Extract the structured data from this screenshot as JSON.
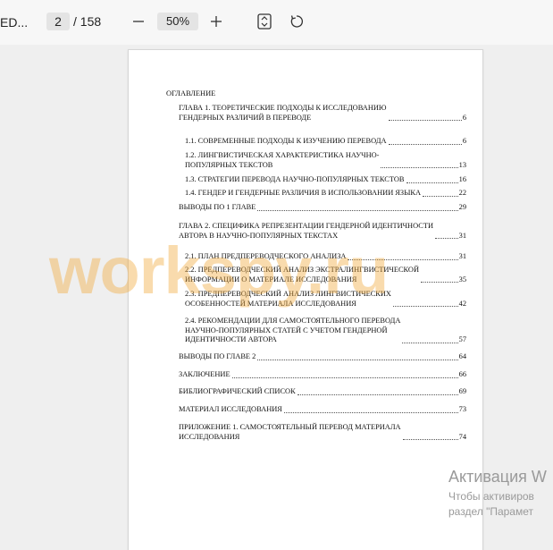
{
  "toolbar": {
    "doc_title": "ED...",
    "current_page": "2",
    "total_pages": "/ 158",
    "zoom": "50%"
  },
  "document": {
    "toc_heading": "ОГЛАВЛЕНИЕ",
    "toc": [
      {
        "text": "ГЛАВА 1. ТЕОРЕТИЧЕСКИЕ ПОДХОДЫ К ИССЛЕДОВАНИЮ\nГЕНДЕРНЫХ РАЗЛИЧИЙ В ПЕРЕВОДЕ",
        "page": "6"
      },
      {
        "text": "1.1.   СОВРЕМЕННЫЕ ПОДХОДЫ К ИЗУЧЕНИЮ ПЕРЕВОДА",
        "page": "6"
      },
      {
        "text": "1.2.   ЛИНГВИСТИЧЕСКАЯ ХАРАКТЕРИСТИКА НАУЧНО-\nПОПУЛЯРНЫХ ТЕКСТОВ",
        "page": "13"
      },
      {
        "text": "1.3. СТРАТЕГИИ ПЕРЕВОДА НАУЧНО-ПОПУЛЯРНЫХ ТЕКСТОВ",
        "page": "16"
      },
      {
        "text": "1.4. ГЕНДЕР И ГЕНДЕРНЫЕ РАЗЛИЧИЯ В ИСПОЛЬЗОВАНИИ ЯЗЫКА",
        "page": "22"
      },
      {
        "text": "ВЫВОДЫ ПО 1 ГЛАВЕ",
        "page": "29"
      },
      {
        "text": "ГЛАВА 2. СПЕЦИФИКА РЕПРЕЗЕНТАЦИИ ГЕНДЕРНОЙ ИДЕНТИЧНОСТИ\nАВТОРА В НАУЧНО-ПОПУЛЯРНЫХ ТЕКСТАХ",
        "page": "31"
      },
      {
        "text": "2.1. ПЛАН ПРЕДПЕРЕВОДЧЕСКОГО АНАЛИЗА",
        "page": "31"
      },
      {
        "text": "2.2. ПРЕДПЕРЕВОДЧЕСКИЙ АНАЛИЗ ЭКСТРАЛИНГВИСТИЧЕСКОЙ\nИНФОРМАЦИИ О МАТЕРИАЛЕ ИССЛЕДОВАНИЯ",
        "page": "35"
      },
      {
        "text": "2.3. ПРЕДПЕРЕВОДЧЕСКИЙ АНАЛИЗ ЛИНГВИСТИЧЕСКИХ\nОСОБЕННОСТЕЙ МАТЕРИАЛА ИССЛЕДОВАНИЯ",
        "page": "42"
      },
      {
        "text": "2.4. РЕКОМЕНДАЦИИ ДЛЯ САМОСТОЯТЕЛЬНОГО ПЕРЕВОДА\nНАУЧНО-ПОПУЛЯРНЫХ СТАТЕЙ С УЧЕТОМ ГЕНДЕРНОЙ\nИДЕНТИЧНОСТИ АВТОРА",
        "page": "57"
      },
      {
        "text": "ВЫВОДЫ ПО ГЛАВЕ 2",
        "page": "64"
      },
      {
        "text": "ЗАКЛЮЧЕНИЕ",
        "page": "66"
      },
      {
        "text": "БИБЛИОГРАФИЧЕСКИЙ СПИСОК",
        "page": "69"
      },
      {
        "text": "МАТЕРИАЛ ИССЛЕДОВАНИЯ",
        "page": "73"
      },
      {
        "text": "ПРИЛОЖЕНИЕ 1. САМОСТОЯТЕЛЬНЫЙ ПЕРЕВОД МАТЕРИАЛА\nИССЛЕДОВАНИЯ",
        "page": "74"
      }
    ]
  },
  "watermark": "workspy.ru",
  "activation": {
    "title": "Активация W",
    "line1": "Чтобы активиров",
    "line2": "раздел \"Парамет"
  },
  "icons": {
    "zoom_out": "minus-icon",
    "zoom_in": "plus-icon",
    "fit": "fit-page-icon",
    "rotate": "rotate-icon"
  }
}
